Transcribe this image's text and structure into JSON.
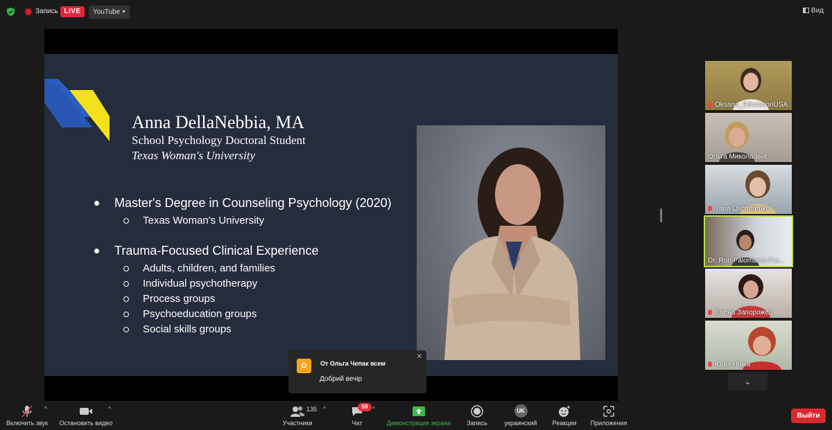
{
  "topbar": {
    "recording_label": "Запись",
    "live_badge": "LIVE",
    "stream_target": "YouTube",
    "view_label": "Вид"
  },
  "slide": {
    "name": "Anna DellaNebbia, MA",
    "role": "School Psychology Doctoral Student",
    "university": "Texas Woman's University",
    "bullets": [
      {
        "text": "Master's Degree in Counseling Psychology (2020)",
        "subs": [
          "Texas Woman's University"
        ]
      },
      {
        "text": "Trauma-Focused Clinical Experience",
        "subs": [
          "Adults, children, and families",
          "Individual psychotherapy",
          "Process groups",
          "Psychoeducation groups",
          "Social skills groups"
        ]
      }
    ]
  },
  "chat_toast": {
    "avatar_letter": "О",
    "from": "От Ольга Чепак всем",
    "message": "Добрий вечір",
    "close": "✕"
  },
  "participants": [
    {
      "name": "Oksana_EducationUSA",
      "muted": true
    },
    {
      "name": "Ольга Миколаївна",
      "muted": false
    },
    {
      "name": "Yana Ovcharenko",
      "muted": true
    },
    {
      "name": "Dr. Ron Palomares-Fer...",
      "muted": false,
      "active": true
    },
    {
      "name": "Елена Запорожец",
      "muted": true
    },
    {
      "name": "Юлія Ніяка",
      "muted": true
    }
  ],
  "toolbar": {
    "unmute": "Включить звук",
    "stop_video": "Остановить видео",
    "participants": "Участники",
    "participant_count": "135",
    "chat": "Чат",
    "chat_badge": "59",
    "share_screen": "Демонстрация экрана",
    "record": "Запись",
    "interpretation": "украинский",
    "interpretation_code": "UK",
    "reactions": "Реакции",
    "apps": "Приложения",
    "leave": "Выйти"
  },
  "colors": {
    "live": "#e0263a",
    "share_green": "#3dba4e",
    "active_speaker": "#b8e03e",
    "leave": "#d9292e",
    "slide_bg": "#252c3c"
  }
}
